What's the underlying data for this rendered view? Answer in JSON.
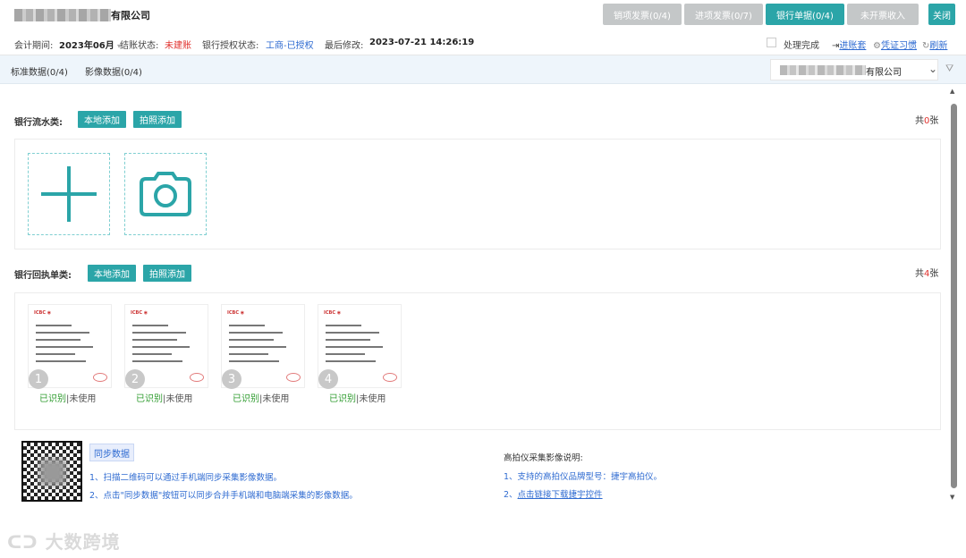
{
  "header": {
    "company_suffix": "有限公司",
    "buttons": [
      {
        "label": "销项发票(0/4)",
        "active": false
      },
      {
        "label": "进项发票(0/7)",
        "active": false
      },
      {
        "label": "银行单据(0/4)",
        "active": true
      },
      {
        "label": "未开票收入",
        "active": false
      },
      {
        "label": "关闭",
        "active": true
      }
    ]
  },
  "meta": {
    "period_label": "会计期间:",
    "period_value": "2023年06月",
    "account_status_label": "结账状态:",
    "account_status_value": "未建账",
    "bank_auth_label": "银行授权状态:",
    "bank_auth_value": "工商-已授权",
    "last_modified_label": "最后修改:",
    "last_modified_value": "2023-07-21 14:26:19",
    "processed_label": "处理完成",
    "enter_set_label": "进账套",
    "voucher_label": "凭证习惯",
    "refresh_label": "刷新"
  },
  "tabs": {
    "standard": "标准数据(0/4)",
    "image": "影像数据(0/4)",
    "company_suffix": "有限公司"
  },
  "bank_statement": {
    "label": "银行流水类:",
    "local_add": "本地添加",
    "photo_add": "拍照添加",
    "count_prefix": "共",
    "count": "0",
    "count_suffix": "张"
  },
  "bank_receipt": {
    "label": "银行回执单类:",
    "local_add": "本地添加",
    "photo_add": "拍照添加",
    "count_prefix": "共",
    "count": "4",
    "count_suffix": "张",
    "items": [
      {
        "index": "1",
        "recognized": "已识别",
        "sep": "|",
        "usage": "未使用"
      },
      {
        "index": "2",
        "recognized": "已识别",
        "sep": "|",
        "usage": "未使用"
      },
      {
        "index": "3",
        "recognized": "已识别",
        "sep": "|",
        "usage": "未使用"
      },
      {
        "index": "4",
        "recognized": "已识别",
        "sep": "|",
        "usage": "未使用"
      }
    ]
  },
  "sync": {
    "button": "同步数据",
    "note1": "1、扫描二维码可以通过手机端同步采集影像数据。",
    "note2": "2、点击\"同步数据\"按钮可以同步合并手机端和电脑端采集的影像数据。"
  },
  "scanner": {
    "title": "高拍仪采集影像说明:",
    "note1": "1、支持的高拍仪品牌型号：捷宇高拍仪。",
    "note2_prefix": "2、",
    "note2_link": "点击链接下载捷宇控件"
  },
  "watermark": "大数跨境",
  "colors": {
    "accent": "#2ba5a8",
    "link": "#2f6bd1",
    "warn": "#e0312d",
    "ok": "#2e9b2e"
  }
}
